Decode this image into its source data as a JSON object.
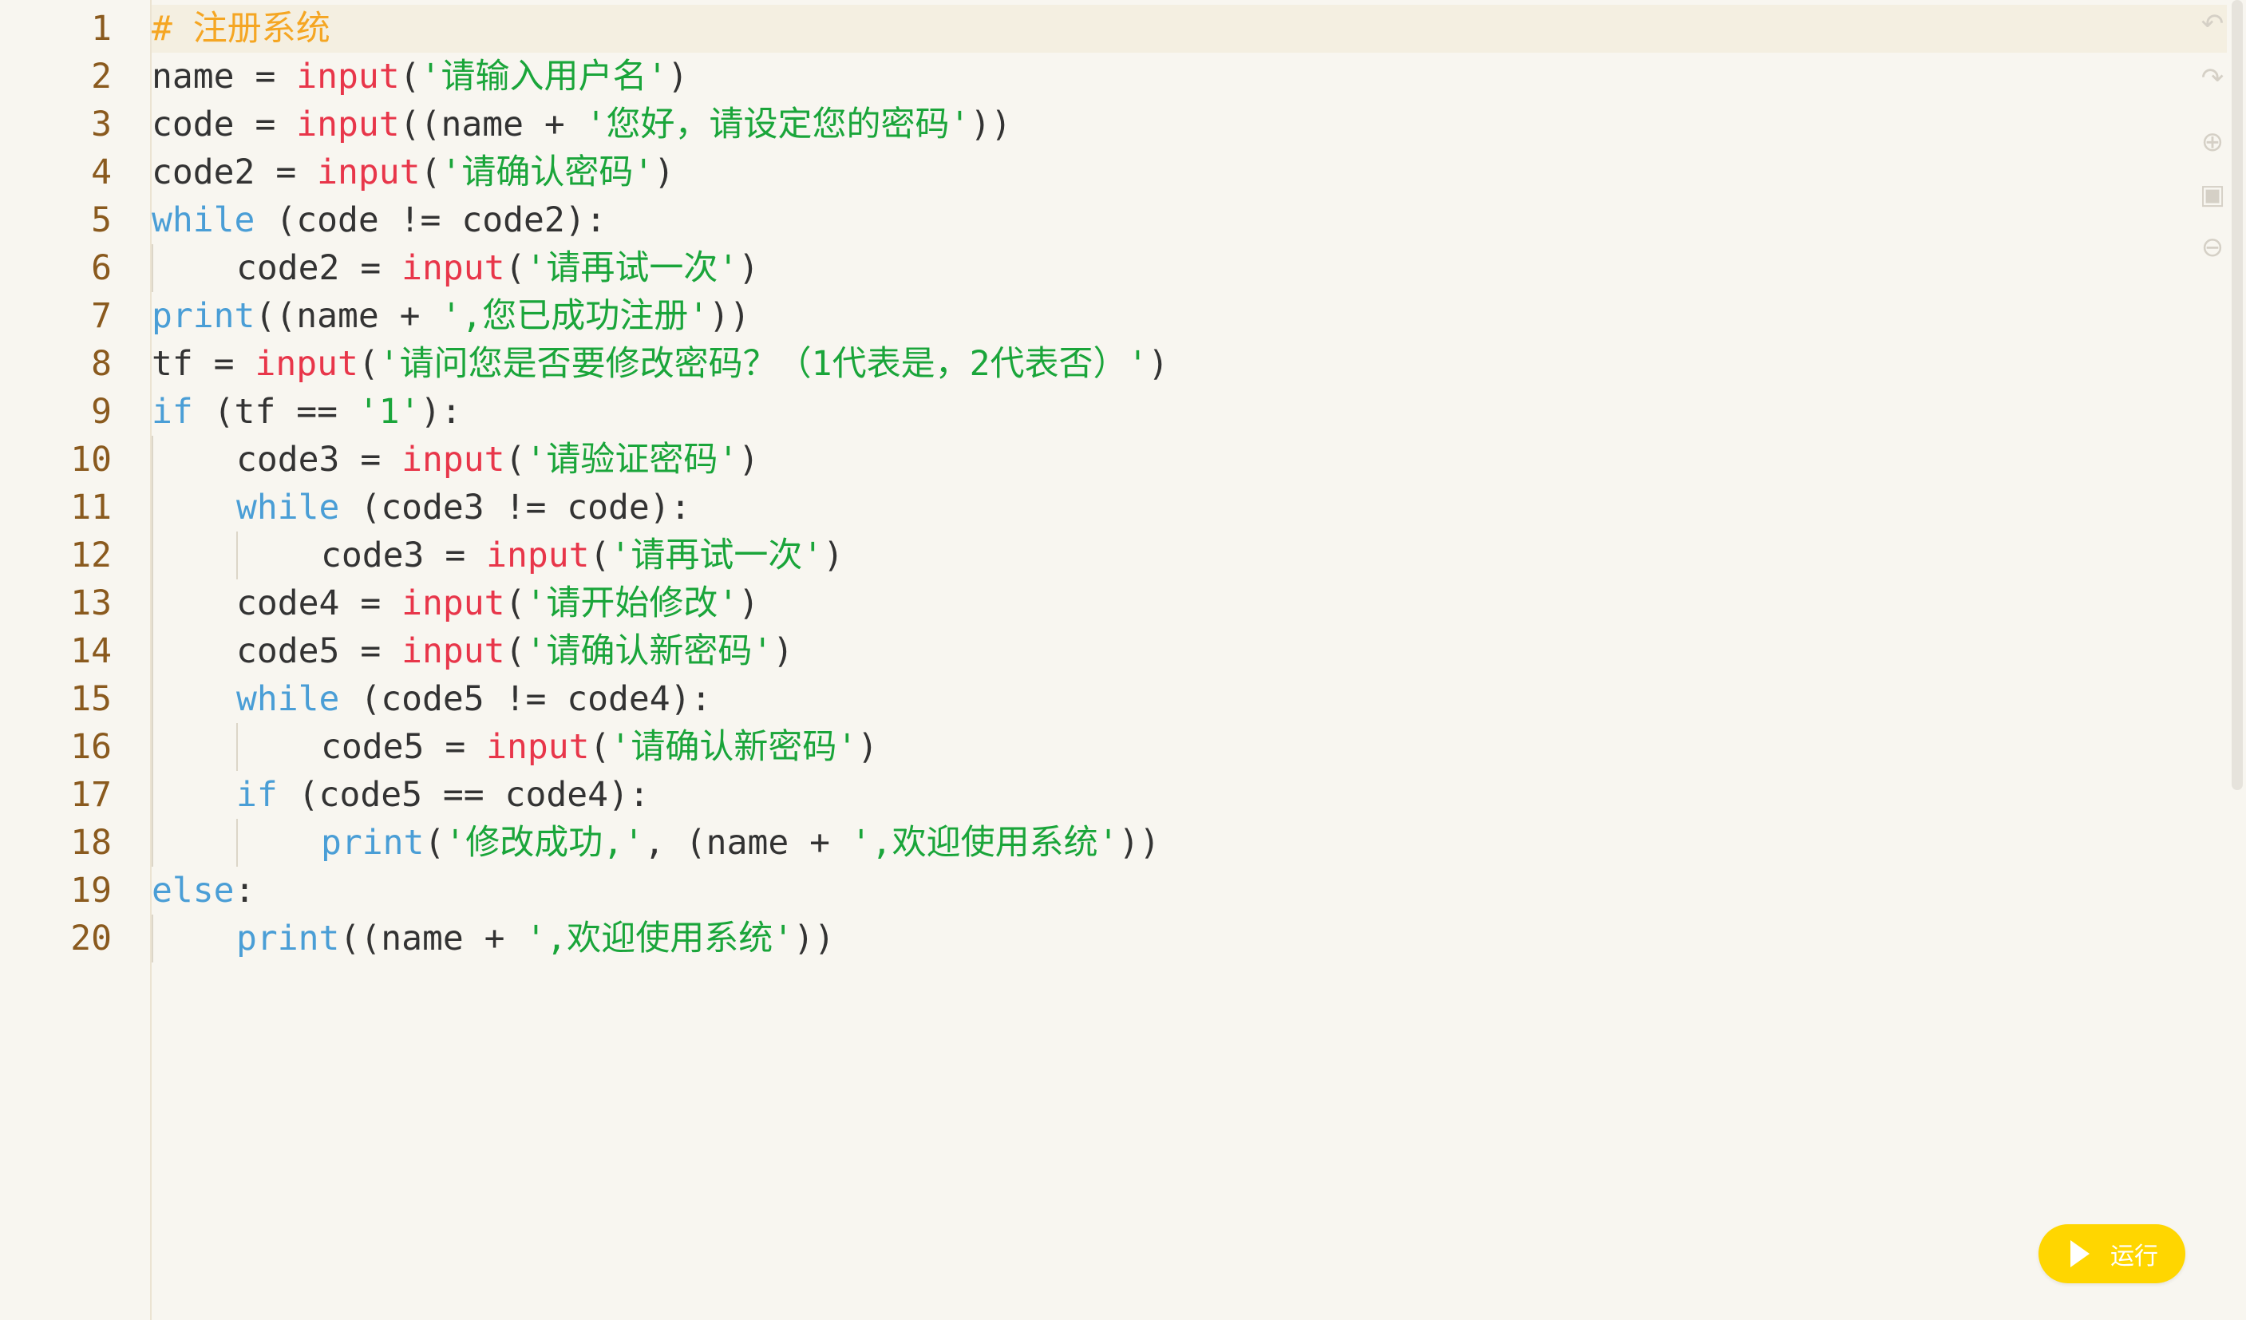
{
  "editor": {
    "lines": [
      {
        "num": "1",
        "indent": 0,
        "tokens": [
          [
            "comment",
            "# 注册系统"
          ]
        ]
      },
      {
        "num": "2",
        "indent": 0,
        "tokens": [
          [
            "plain",
            "name = "
          ],
          [
            "fn",
            "input"
          ],
          [
            "plain",
            "("
          ],
          [
            "str",
            "'请输入用户名'"
          ],
          [
            "plain",
            ")"
          ]
        ]
      },
      {
        "num": "3",
        "indent": 0,
        "tokens": [
          [
            "plain",
            "code = "
          ],
          [
            "fn",
            "input"
          ],
          [
            "plain",
            "((name + "
          ],
          [
            "str",
            "'您好，请设定您的密码'"
          ],
          [
            "plain",
            "))"
          ]
        ]
      },
      {
        "num": "4",
        "indent": 0,
        "tokens": [
          [
            "plain",
            "code2 = "
          ],
          [
            "fn",
            "input"
          ],
          [
            "plain",
            "("
          ],
          [
            "str",
            "'请确认密码'"
          ],
          [
            "plain",
            ")"
          ]
        ]
      },
      {
        "num": "5",
        "indent": 0,
        "tokens": [
          [
            "kw",
            "while"
          ],
          [
            "plain",
            " (code != code2):"
          ]
        ]
      },
      {
        "num": "6",
        "indent": 1,
        "tokens": [
          [
            "plain",
            "code2 = "
          ],
          [
            "fn",
            "input"
          ],
          [
            "plain",
            "("
          ],
          [
            "str",
            "'请再试一次'"
          ],
          [
            "plain",
            ")"
          ]
        ]
      },
      {
        "num": "7",
        "indent": 0,
        "tokens": [
          [
            "kw",
            "print"
          ],
          [
            "plain",
            "((name + "
          ],
          [
            "str",
            "',您已成功注册'"
          ],
          [
            "plain",
            "))"
          ]
        ]
      },
      {
        "num": "8",
        "indent": 0,
        "tokens": [
          [
            "plain",
            "tf = "
          ],
          [
            "fn",
            "input"
          ],
          [
            "plain",
            "("
          ],
          [
            "str",
            "'请问您是否要修改密码？（1代表是，2代表否）'"
          ],
          [
            "plain",
            ")"
          ]
        ]
      },
      {
        "num": "9",
        "indent": 0,
        "tokens": [
          [
            "kw",
            "if"
          ],
          [
            "plain",
            " (tf == "
          ],
          [
            "str",
            "'1'"
          ],
          [
            "plain",
            "):"
          ]
        ]
      },
      {
        "num": "10",
        "indent": 1,
        "tokens": [
          [
            "plain",
            "code3 = "
          ],
          [
            "fn",
            "input"
          ],
          [
            "plain",
            "("
          ],
          [
            "str",
            "'请验证密码'"
          ],
          [
            "plain",
            ")"
          ]
        ]
      },
      {
        "num": "11",
        "indent": 1,
        "tokens": [
          [
            "kw",
            "while"
          ],
          [
            "plain",
            " (code3 != code):"
          ]
        ]
      },
      {
        "num": "12",
        "indent": 2,
        "tokens": [
          [
            "plain",
            "code3 = "
          ],
          [
            "fn",
            "input"
          ],
          [
            "plain",
            "("
          ],
          [
            "str",
            "'请再试一次'"
          ],
          [
            "plain",
            ")"
          ]
        ]
      },
      {
        "num": "13",
        "indent": 1,
        "tokens": [
          [
            "plain",
            "code4 = "
          ],
          [
            "fn",
            "input"
          ],
          [
            "plain",
            "("
          ],
          [
            "str",
            "'请开始修改'"
          ],
          [
            "plain",
            ")"
          ]
        ]
      },
      {
        "num": "14",
        "indent": 1,
        "tokens": [
          [
            "plain",
            "code5 = "
          ],
          [
            "fn",
            "input"
          ],
          [
            "plain",
            "("
          ],
          [
            "str",
            "'请确认新密码'"
          ],
          [
            "plain",
            ")"
          ]
        ]
      },
      {
        "num": "15",
        "indent": 1,
        "tokens": [
          [
            "kw",
            "while"
          ],
          [
            "plain",
            " (code5 != code4):"
          ]
        ]
      },
      {
        "num": "16",
        "indent": 2,
        "tokens": [
          [
            "plain",
            "code5 = "
          ],
          [
            "fn",
            "input"
          ],
          [
            "plain",
            "("
          ],
          [
            "str",
            "'请确认新密码'"
          ],
          [
            "plain",
            ")"
          ]
        ]
      },
      {
        "num": "17",
        "indent": 1,
        "tokens": [
          [
            "kw",
            "if"
          ],
          [
            "plain",
            " (code5 == code4):"
          ]
        ]
      },
      {
        "num": "18",
        "indent": 2,
        "tokens": [
          [
            "kw",
            "print"
          ],
          [
            "plain",
            "("
          ],
          [
            "str",
            "'修改成功,'"
          ],
          [
            "plain",
            ", (name + "
          ],
          [
            "str",
            "',欢迎使用系统'"
          ],
          [
            "plain",
            "))"
          ]
        ]
      },
      {
        "num": "19",
        "indent": 0,
        "tokens": [
          [
            "kw",
            "else"
          ],
          [
            "plain",
            ":"
          ]
        ]
      },
      {
        "num": "20",
        "indent": 1,
        "tokens": [
          [
            "kw",
            "print"
          ],
          [
            "plain",
            "((name + "
          ],
          [
            "str",
            "',欢迎使用系统'"
          ],
          [
            "plain",
            "))"
          ]
        ]
      }
    ]
  },
  "toolbar": {
    "icons": [
      "undo-icon",
      "redo-icon",
      "zoom-in-icon",
      "fullscreen-icon",
      "zoom-out-icon"
    ]
  },
  "run_button": {
    "label": "运行"
  },
  "colors": {
    "background": "#f8f6f0",
    "line_number": "#8a5a1e",
    "comment": "#f5a623",
    "keyword": "#4a9ed6",
    "builtin_input": "#e8364a",
    "string": "#1aa53a",
    "run_button": "#ffd600"
  }
}
